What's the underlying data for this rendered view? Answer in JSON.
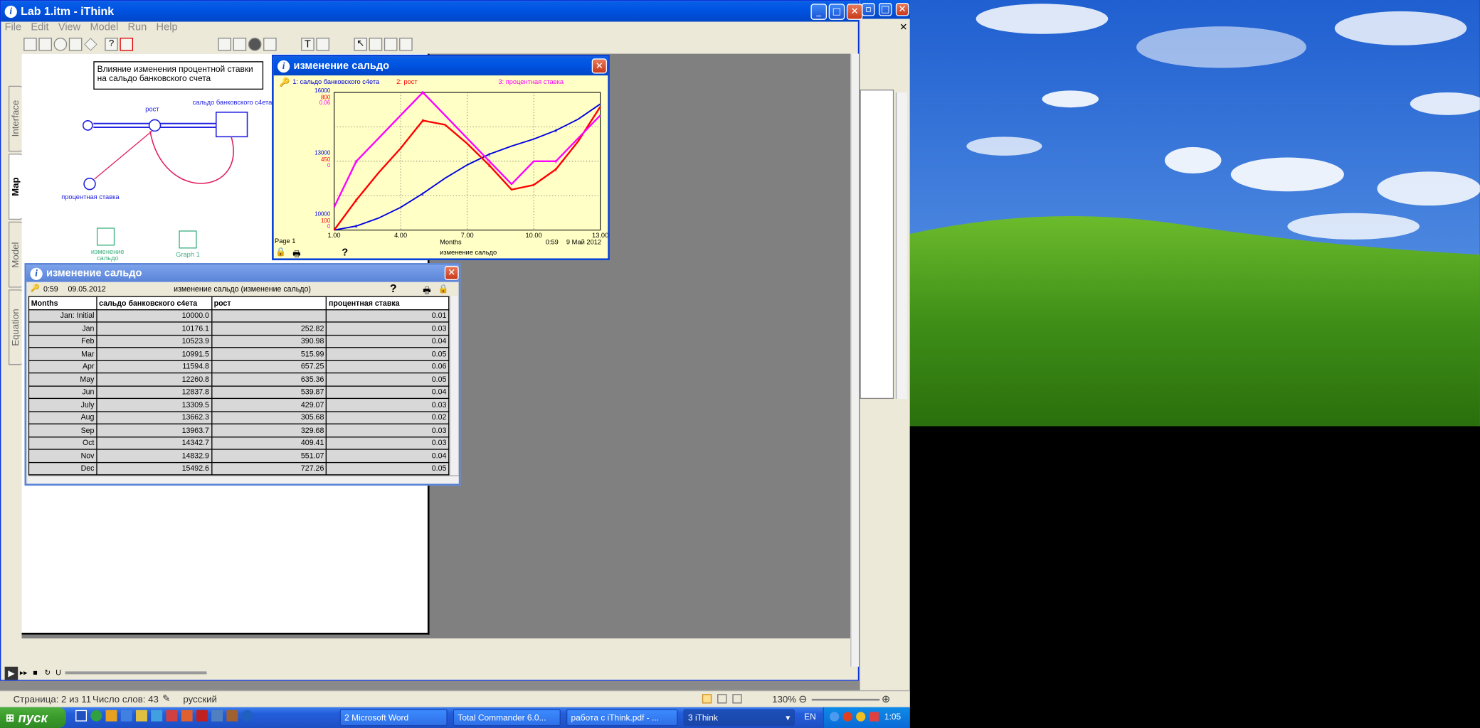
{
  "app": {
    "title": "Lab 1.itm - iThink",
    "menu": [
      "File",
      "Edit",
      "View",
      "Model",
      "Run",
      "Help"
    ],
    "side_tabs": [
      "Interface",
      "Map",
      "Model",
      "Equation"
    ]
  },
  "map": {
    "note_line1": "Влияние изменения процентной ставки",
    "note_line2": "на сальдо банковского счета",
    "stock_label": "сальдо банковского с4ета",
    "flow_label": "рост",
    "converter_label": "процентная ставка",
    "table_icon_label": "изменение",
    "table_icon_label2": "сальдо",
    "graph_icon_label": "Graph 1"
  },
  "graph_window": {
    "title": "изменение сальдо",
    "legend": [
      "1: сальдо банковского с4ета",
      "2: рост",
      "3: процентная ставка"
    ],
    "colors": {
      "s1": "#0000e0",
      "s2": "#ff0000",
      "s3": "#ff00ff"
    },
    "y_top": [
      "16000",
      "800",
      "0.06"
    ],
    "y_mid": [
      "13000",
      "450",
      "0"
    ],
    "y_bot": [
      "10000",
      "100",
      "0"
    ],
    "x_ticks": [
      "1.00",
      "4.00",
      "7.00",
      "10.00",
      "13.00"
    ],
    "xlabel": "Months",
    "page": "Page 1",
    "time": "0:59",
    "date": "9 Май 2012",
    "footer_title": "изменение сальдо",
    "question": "?"
  },
  "chart_data": {
    "type": "line",
    "title": "изменение сальдо",
    "xlabel": "Months",
    "xlim": [
      1,
      13
    ],
    "x": [
      1,
      2,
      3,
      4,
      5,
      6,
      7,
      8,
      9,
      10,
      11,
      12,
      13
    ],
    "series": [
      {
        "name": "1: сальдо банковского с4ета",
        "color": "#0000e0",
        "ylim": [
          10000,
          16000
        ],
        "values": [
          10000,
          10176.1,
          10523.9,
          10991.5,
          11594.8,
          12260.8,
          12837.8,
          13309.5,
          13662.3,
          13963.7,
          14342.7,
          14832.9,
          15492.6
        ]
      },
      {
        "name": "2: рост",
        "color": "#ff0000",
        "ylim": [
          100,
          800
        ],
        "values": [
          100,
          252.82,
          390.98,
          515.99,
          657.25,
          635.36,
          539.87,
          429.07,
          305.68,
          329.68,
          409.41,
          551.07,
          727.26
        ]
      },
      {
        "name": "3: процентная ставка",
        "color": "#ff00ff",
        "ylim": [
          0,
          0.06
        ],
        "values": [
          0.01,
          0.03,
          0.04,
          0.05,
          0.06,
          0.05,
          0.04,
          0.03,
          0.02,
          0.03,
          0.03,
          0.04,
          0.05
        ]
      }
    ]
  },
  "table_window": {
    "title": "изменение сальдо",
    "time": "0:59",
    "date": "09.05.2012",
    "caption": "изменение  сальдо (изменение сальдо)",
    "question": "?",
    "headers": [
      "Months",
      "сальдо банковского с4ета",
      "рост",
      "процентная ставка"
    ],
    "rows": [
      [
        "Jan: Initial",
        "10000.0",
        "",
        "0.01"
      ],
      [
        "Jan",
        "10176.1",
        "252.82",
        "0.03"
      ],
      [
        "Feb",
        "10523.9",
        "390.98",
        "0.04"
      ],
      [
        "Mar",
        "10991.5",
        "515.99",
        "0.05"
      ],
      [
        "Apr",
        "11594.8",
        "657.25",
        "0.06"
      ],
      [
        "May",
        "12260.8",
        "635.36",
        "0.05"
      ],
      [
        "Jun",
        "12837.8",
        "539.87",
        "0.04"
      ],
      [
        "July",
        "13309.5",
        "429.07",
        "0.03"
      ],
      [
        "Aug",
        "13662.3",
        "305.68",
        "0.02"
      ],
      [
        "Sep",
        "13963.7",
        "329.68",
        "0.03"
      ],
      [
        "Oct",
        "14342.7",
        "409.41",
        "0.03"
      ],
      [
        "Nov",
        "14832.9",
        "551.07",
        "0.04"
      ],
      [
        "Dec",
        "15492.6",
        "727.26",
        "0.05"
      ]
    ]
  },
  "word_status": {
    "page": "Страница: 2 из 11",
    "words": "Число слов: 43",
    "lang": "русский",
    "zoom": "130%"
  },
  "taskbar": {
    "start": "пуск",
    "items": [
      "2 Microsoft Word",
      "Total Commander 6.0...",
      "работа с iThink.pdf - ...",
      "3 iThink"
    ],
    "lang": "EN",
    "clock": "1:05"
  }
}
